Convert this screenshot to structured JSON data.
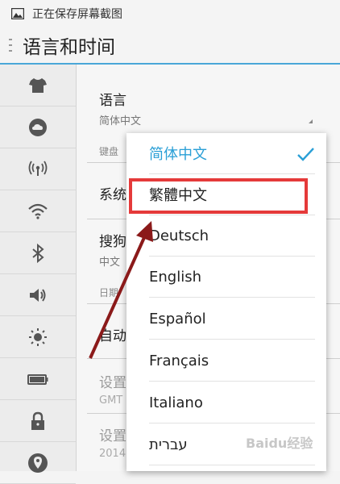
{
  "status_bar": {
    "text": "正在保存屏幕截图",
    "icon": "image-icon"
  },
  "action_bar": {
    "title": "语言和时间"
  },
  "sidebar": {
    "items": [
      {
        "icon": "tshirt-icon"
      },
      {
        "icon": "cloud-icon"
      },
      {
        "icon": "antenna-icon"
      },
      {
        "icon": "wifi-icon"
      },
      {
        "icon": "bluetooth-icon"
      },
      {
        "icon": "volume-icon"
      },
      {
        "icon": "brightness-icon"
      },
      {
        "icon": "battery-icon"
      },
      {
        "icon": "lock-icon"
      },
      {
        "icon": "location-icon"
      }
    ]
  },
  "content": {
    "language_label": "语言",
    "language_value": "简体中文",
    "keyboard_header": "键盘",
    "system_label": "系统",
    "sogou_label": "搜狗",
    "sogou_sub": "中文",
    "date_header": "日期",
    "auto_label": "自动",
    "set_label_1": "设置",
    "set_sub_1": "GMT",
    "set_label_2": "设置",
    "set_sub_2": "2014"
  },
  "language_popup": {
    "options": [
      "简体中文",
      "繁體中文",
      "Deutsch",
      "English",
      "Español",
      "Français",
      "Italiano",
      "עברית"
    ],
    "selected_index": 0
  },
  "colors": {
    "accent": "#2a9fd6",
    "highlight": "#e53a3a",
    "arrow": "#8b1a1a"
  },
  "watermark": "Baidu经验"
}
